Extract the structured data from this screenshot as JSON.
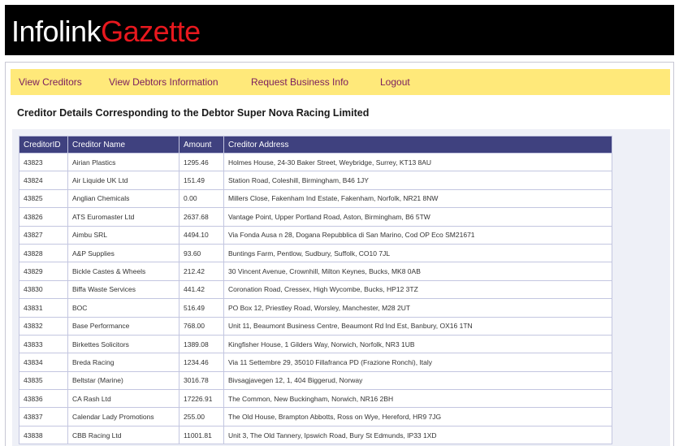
{
  "brand": {
    "part1": "Infolink",
    "part2": "Gazette"
  },
  "nav": [
    {
      "label": "View Creditors"
    },
    {
      "label": "View Debtors Information"
    },
    {
      "label": "Request Business Info"
    },
    {
      "label": "Logout"
    }
  ],
  "page_title": "Creditor Details Corresponding to the Debtor Super Nova Racing Limited",
  "table": {
    "headers": [
      "CreditorID",
      "Creditor Name",
      "Amount",
      "Creditor Address"
    ],
    "rows": [
      [
        "43823",
        "Airian Plastics",
        "1295.46",
        "Holmes House, 24-30 Baker Street, Weybridge, Surrey, KT13 8AU"
      ],
      [
        "43824",
        "Air Liquide UK Ltd",
        "151.49",
        "Station Road, Coleshill, Birmingham, B46 1JY"
      ],
      [
        "43825",
        "Anglian Chemicals",
        "0.00",
        "Millers Close, Fakenham Ind Estate, Fakenham, Norfolk, NR21 8NW"
      ],
      [
        "43826",
        "ATS Euromaster Ltd",
        "2637.68",
        "Vantage Point, Upper Portland Road, Aston, Birmingham, B6 5TW"
      ],
      [
        "43827",
        "Aimbu SRL",
        "4494.10",
        "Via Fonda Ausa n 28, Dogana Repubblica di San Marino, Cod OP Eco SM21671"
      ],
      [
        "43828",
        "A&P Supplies",
        "93.60",
        "Buntings Farm, Pentlow, Sudbury, Suffolk, CO10 7JL"
      ],
      [
        "43829",
        "Bickle Castes & Wheels",
        "212.42",
        "30 Vincent Avenue, Crownhill, Milton Keynes, Bucks, MK8 0AB"
      ],
      [
        "43830",
        "Biffa Waste Services",
        "441.42",
        "Coronation Road, Cressex, High Wycombe, Bucks, HP12 3TZ"
      ],
      [
        "43831",
        "BOC",
        "516.49",
        "PO Box 12, Priestley Road, Worsley, Manchester, M28 2UT"
      ],
      [
        "43832",
        "Base Performance",
        "768.00",
        "Unit 11, Beaumont Business Centre, Beaumont Rd Ind Est, Banbury, OX16 1TN"
      ],
      [
        "43833",
        "Birkettes Solicitors",
        "1389.08",
        "Kingfisher House, 1 Gilders Way, Norwich, Norfolk, NR3 1UB"
      ],
      [
        "43834",
        "Breda Racing",
        "1234.46",
        "Via 11 Settembre 29, 35010 Fillafranca PD (Frazione Ronchi), Italy"
      ],
      [
        "43835",
        "Beltstar (Marine)",
        "3016.78",
        "Bivsagjavegen 12, 1, 404 Biggerud, Norway"
      ],
      [
        "43836",
        "CA Rash Ltd",
        "17226.91",
        "The Common, New Buckingham, Norwich, NR16 2BH"
      ],
      [
        "43837",
        "Calendar Lady Promotions",
        "255.00",
        "The Old House, Brampton Abbotts, Ross on Wye, Hereford, HR9 7JG"
      ],
      [
        "43838",
        "CBB Racing Ltd",
        "11001.81",
        "Unit 3, The Old Tannery, Ipswich Road, Bury St Edmunds, IP33 1XD"
      ]
    ]
  }
}
